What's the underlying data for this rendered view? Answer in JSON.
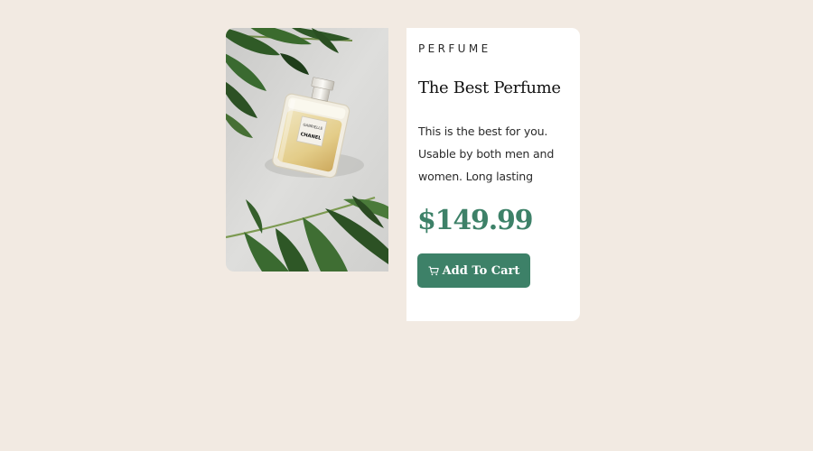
{
  "product": {
    "image_alt": "Gabrielle Chanel perfume bottle on leaves",
    "bottle_label_line1": "GABRIELLE",
    "bottle_label_line2": "CHANEL",
    "category": "PERFUME",
    "title": "The Best Perfume",
    "description": "This is the best for you. Usable by both men and women. Long lasting",
    "price": "$149.99",
    "add_to_cart_label": "Add To Cart",
    "cart_icon": "cart-icon"
  },
  "colors": {
    "background": "#f2eae2",
    "card": "#ffffff",
    "accent": "#3d8168",
    "text": "#111111"
  }
}
